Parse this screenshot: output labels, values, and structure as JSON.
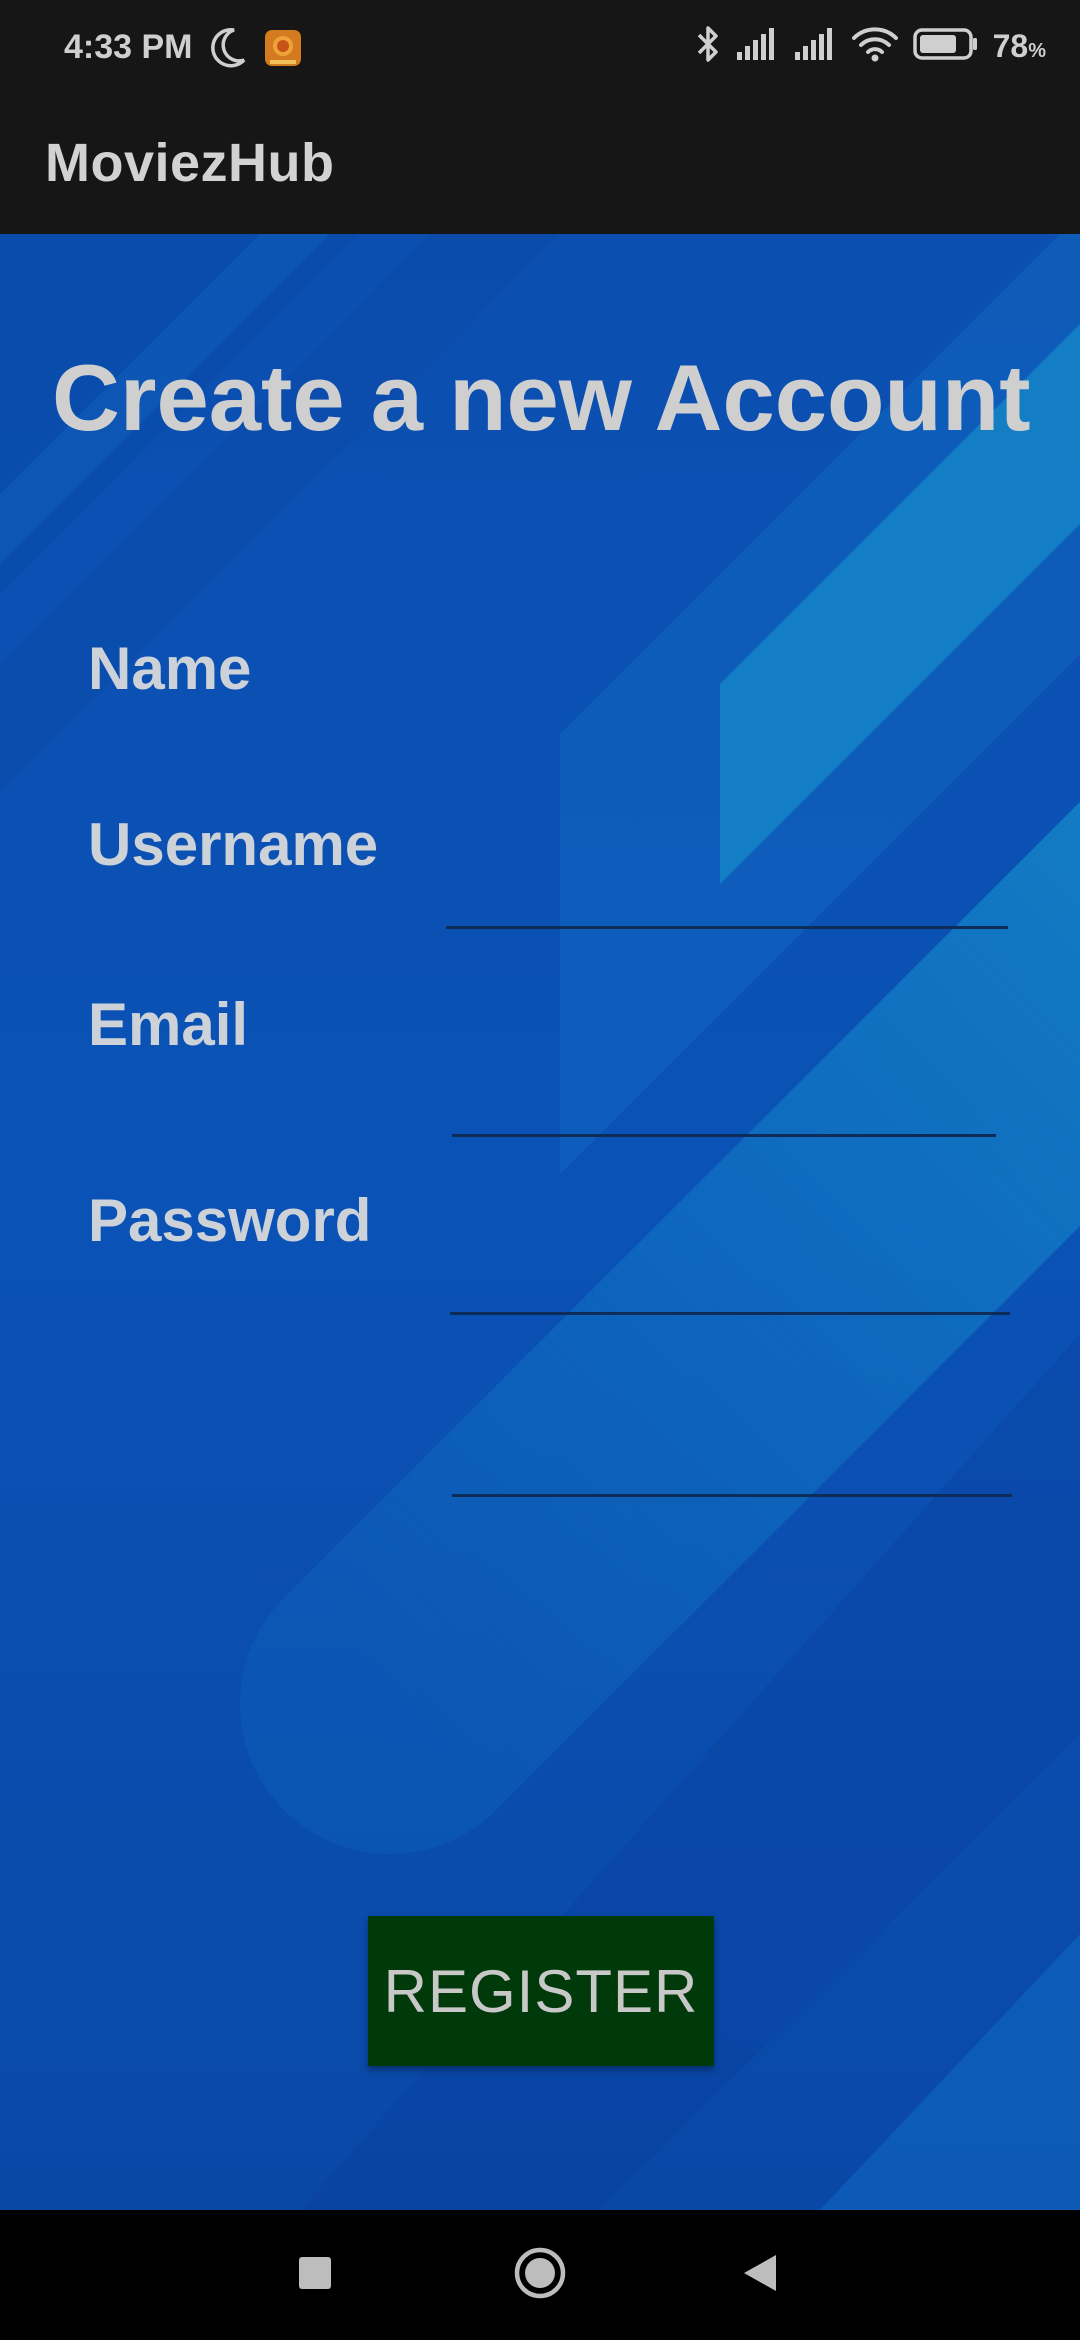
{
  "status_bar": {
    "time": "4:33 PM",
    "battery_percent": "78",
    "battery_unit": "%",
    "battery_level": 0.78,
    "icons": [
      "moon-icon",
      "app-notification-icon",
      "bluetooth-icon",
      "signal-icon",
      "signal-icon",
      "wifi-icon",
      "battery-icon"
    ]
  },
  "app_bar": {
    "title": "MoviezHub"
  },
  "form": {
    "heading": "Create a new Account",
    "fields": [
      {
        "label": "Name",
        "value": "",
        "placeholder": ""
      },
      {
        "label": "Username",
        "value": "",
        "placeholder": ""
      },
      {
        "label": "Email",
        "value": "",
        "placeholder": ""
      },
      {
        "label": "Password",
        "value": "",
        "placeholder": ""
      }
    ],
    "register_label": "REGISTER"
  },
  "nav_bar": {
    "icons": [
      "recents-square-icon",
      "home-circle-icon",
      "back-triangle-icon"
    ]
  },
  "colors": {
    "background_blue": "#0b4fb0",
    "accent_cyan": "#1f9fd0",
    "register_green": "#003a0a",
    "bar_dark": "#161616"
  }
}
